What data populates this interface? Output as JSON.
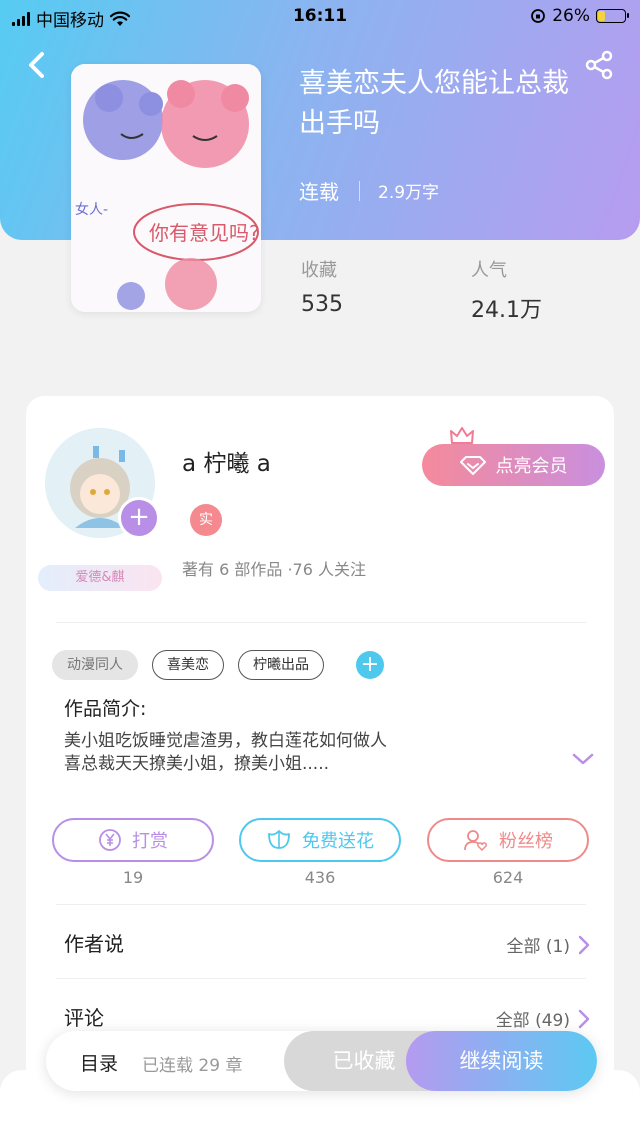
{
  "status_bar": {
    "carrier": "中国移动",
    "time": "16:11",
    "battery": "26%",
    "battery_level": 0.26
  },
  "book": {
    "title": "喜美恋夫人您能让总裁出手吗",
    "status": "连载",
    "word_count": "2.9万字",
    "stats": [
      {
        "label": "收藏",
        "value": "535"
      },
      {
        "label": "人气",
        "value": "24.1万"
      }
    ]
  },
  "author": {
    "name": "a 柠曦 a",
    "badge_name": "爱德&麒",
    "real_badge": "实",
    "info": "著有 6 部作品 ·76 人关注",
    "vip_button": "点亮会员"
  },
  "tags": [
    "动漫同人",
    "喜美恋",
    "柠曦出品"
  ],
  "intro": {
    "title": "作品简介:",
    "lines": [
      "美小姐吃饭睡觉虐渣男，教白莲花如何做人",
      "喜总裁天天撩美小姐，撩美小姐....."
    ]
  },
  "actions": [
    {
      "label": "打赏",
      "count": "19",
      "color": "#b98ee6"
    },
    {
      "label": "免费送花",
      "count": "436",
      "color": "#4fc8ee"
    },
    {
      "label": "粉丝榜",
      "count": "624",
      "color": "#ef8a8a"
    }
  ],
  "sections": [
    {
      "title": "作者说",
      "more": "全部 (1)"
    },
    {
      "title": "评论",
      "more": "全部 (49)"
    }
  ],
  "bottom_bar": {
    "toc": "目录",
    "chapters": "已连载 29 章",
    "collected": "已收藏",
    "continue": "继续阅读"
  },
  "colors": {
    "accent_purple": "#b98ee6",
    "accent_blue": "#4fc8ee",
    "accent_pink": "#ef8a8a"
  }
}
